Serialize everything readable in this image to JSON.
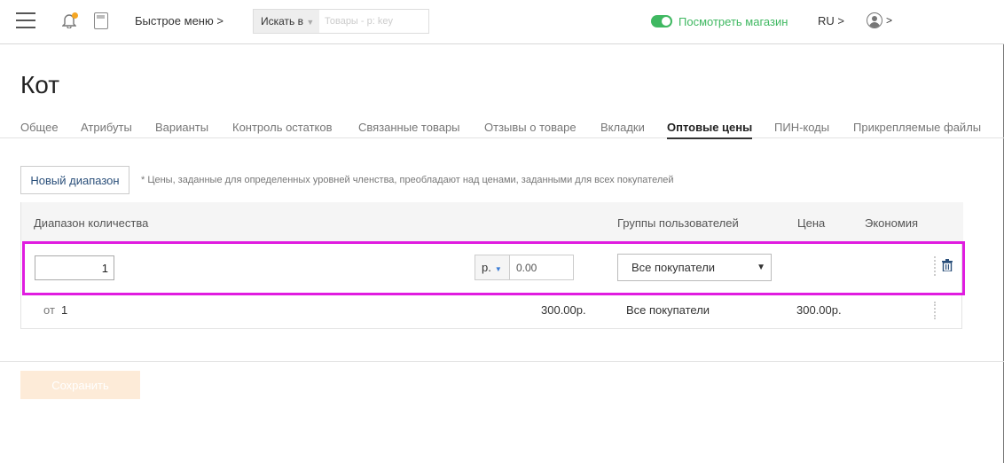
{
  "colors": {
    "accent_green": "#3fb861",
    "notification": "#f5a623",
    "highlight_border": "#e01ce0",
    "save_button_bg": "#fdebd8",
    "link_blue": "#2a4f7a"
  },
  "topbar": {
    "menu_icon": "hamburger-icon",
    "bell_icon": "bell-icon",
    "calculator_icon": "calculator-icon",
    "quick_menu": "Быстрое меню >",
    "search_scope": "Искать в",
    "search_placeholder": "Товары - р: key",
    "view_store": "Посмотреть магазин",
    "language": "RU >",
    "user_icon": "user-icon",
    "user_caret": ">"
  },
  "page": {
    "title": "Кот"
  },
  "tabs": [
    {
      "label": "Общее",
      "active": false
    },
    {
      "label": "Атрибуты",
      "active": false
    },
    {
      "label": "Варианты",
      "active": false
    },
    {
      "label": "Контроль остатков",
      "active": false
    },
    {
      "label": "Связанные товары",
      "active": false
    },
    {
      "label": "Отзывы о товаре",
      "active": false
    },
    {
      "label": "Вкладки",
      "active": false
    },
    {
      "label": "Оптовые цены",
      "active": true
    },
    {
      "label": "ПИН-коды",
      "active": false
    },
    {
      "label": "Прикрепляемые файлы",
      "active": false
    }
  ],
  "toolbar": {
    "new_range": "Новый диапазон",
    "note": "* Цены, заданные для определенных уровней членства, преобладают над ценами, заданными для всех покупателей"
  },
  "table": {
    "headers": {
      "qty_range": "Диапазон количества",
      "user_groups": "Группы пользователей",
      "price": "Цена",
      "savings": "Экономия"
    },
    "edit_row": {
      "qty_value": "1",
      "currency": "р.",
      "price_value": "0.00",
      "group": "Все покупатели"
    },
    "rows": [
      {
        "from_label": "от",
        "from_value": "1",
        "amount": "300.00р.",
        "group": "Все покупатели",
        "price": "300.00р."
      }
    ]
  },
  "footer": {
    "save": "Сохранить"
  }
}
